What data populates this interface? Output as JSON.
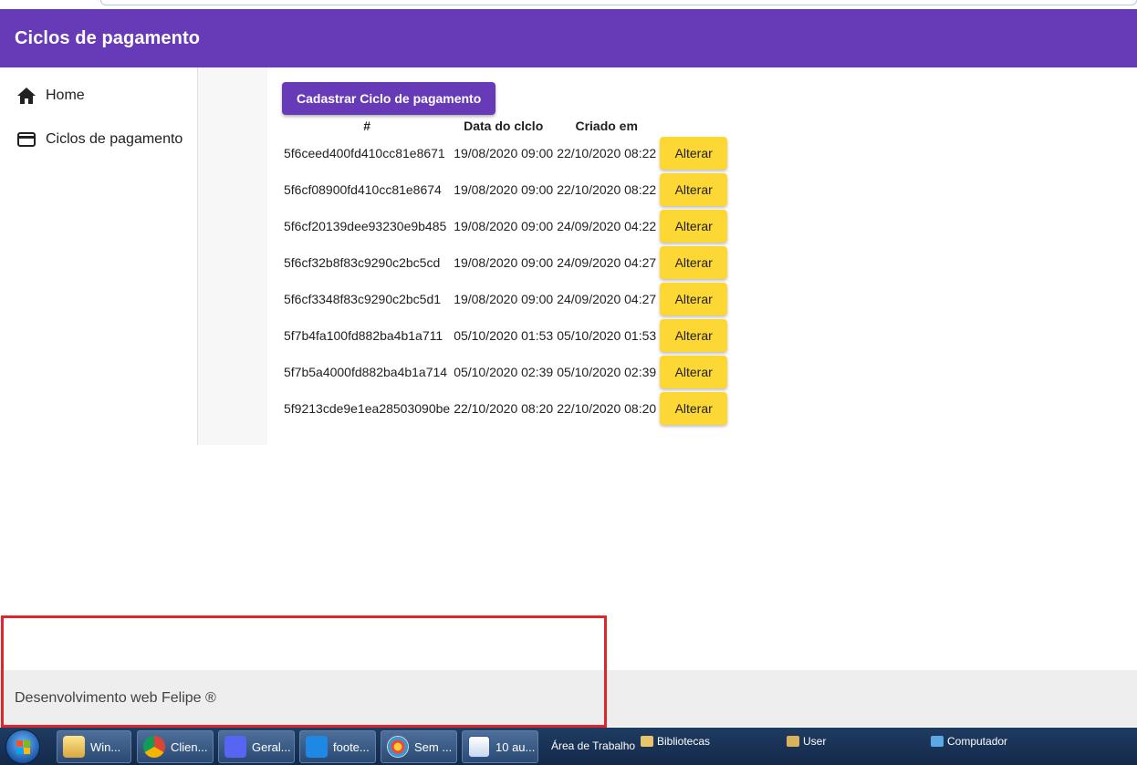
{
  "app": {
    "title": "Ciclos de pagamento"
  },
  "sidebar": {
    "items": [
      {
        "label": "Home",
        "icon": "home-icon"
      },
      {
        "label": "Ciclos de pagamento",
        "icon": "credit-card-icon"
      }
    ]
  },
  "main": {
    "create_button": "Cadastrar Ciclo de pagamento",
    "table": {
      "headers": [
        "#",
        "Data do clclo",
        "Criado em"
      ],
      "action_label": "Alterar",
      "rows": [
        {
          "id": "5f6ceed400fd410cc81e8671",
          "data": "19/08/2020 09:00",
          "criado": "22/10/2020 08:22"
        },
        {
          "id": "5f6cf08900fd410cc81e8674",
          "data": "19/08/2020 09:00",
          "criado": "22/10/2020 08:22"
        },
        {
          "id": "5f6cf20139dee93230e9b485",
          "data": "19/08/2020 09:00",
          "criado": "24/09/2020 04:22"
        },
        {
          "id": "5f6cf32b8f83c9290c2bc5cd",
          "data": "19/08/2020 09:00",
          "criado": "24/09/2020 04:27"
        },
        {
          "id": "5f6cf3348f83c9290c2bc5d1",
          "data": "19/08/2020 09:00",
          "criado": "24/09/2020 04:27"
        },
        {
          "id": "5f7b4fa100fd882ba4b1a711",
          "data": "05/10/2020 01:53",
          "criado": "05/10/2020 01:53"
        },
        {
          "id": "5f7b5a4000fd882ba4b1a714",
          "data": "05/10/2020 02:39",
          "criado": "05/10/2020 02:39"
        },
        {
          "id": "5f9213cde9e1ea28503090be",
          "data": "22/10/2020 08:20",
          "criado": "22/10/2020 08:20"
        }
      ]
    }
  },
  "footer": {
    "text": "Desenvolvimento web Felipe ®"
  },
  "taskbar": {
    "buttons": [
      "Win...",
      "Clien...",
      "Geral...",
      "foote...",
      "Sem ...",
      "10 au..."
    ],
    "labels": [
      "Área de Trabalho",
      "Bibliotecas",
      "User",
      "Computador"
    ]
  },
  "colors": {
    "primary": "#673ab7",
    "action": "#fdd835",
    "highlight_border": "#e0262d"
  }
}
